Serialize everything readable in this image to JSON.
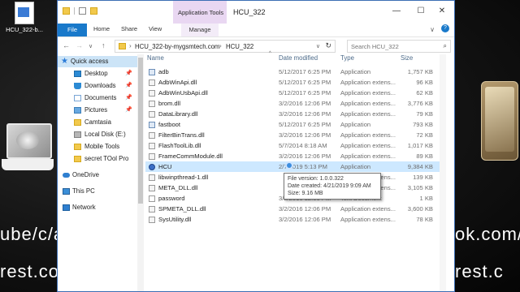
{
  "desktop": {
    "file_icon_label": "HCU_322-b...",
    "bg_text_left_1": "ube/c/a",
    "bg_text_left_2": "rest.com",
    "bg_text_right_1": "ok.com/a",
    "bg_text_right_2": "rest.c"
  },
  "window": {
    "title": "HCU_322",
    "context_tab": "Application Tools",
    "buttons": {
      "minimize": "—",
      "maximize": "☐",
      "close": "✕"
    }
  },
  "ribbon": {
    "tabs": {
      "file": "File",
      "home": "Home",
      "share": "Share",
      "view": "View",
      "manage": "Manage"
    },
    "chevron": "∨",
    "help": "?"
  },
  "address": {
    "crumbs": [
      "HCU_322-by-mygsmtech.com",
      "HCU_322"
    ],
    "separator": "›",
    "search_placeholder": "Search HCU_322"
  },
  "nav": {
    "items": [
      {
        "label": "Quick access",
        "icon": "star-icon",
        "pinned": false
      },
      {
        "label": "Desktop",
        "icon": "desktop-icon",
        "pinned": true
      },
      {
        "label": "Downloads",
        "icon": "downloads-icon",
        "pinned": true
      },
      {
        "label": "Documents",
        "icon": "documents-icon",
        "pinned": true
      },
      {
        "label": "Pictures",
        "icon": "pictures-icon",
        "pinned": true
      },
      {
        "label": "Camtasia",
        "icon": "folder-icon",
        "pinned": false
      },
      {
        "label": "Local Disk (E:)",
        "icon": "disk-icon",
        "pinned": false
      },
      {
        "label": "Mobile Tools",
        "icon": "folder-icon",
        "pinned": false
      },
      {
        "label": "secret TOol Pro",
        "icon": "folder-icon",
        "pinned": false
      },
      {
        "label": "OneDrive",
        "icon": "cloud-icon",
        "pinned": false
      },
      {
        "label": "This PC",
        "icon": "pc-icon",
        "pinned": false
      },
      {
        "label": "Network",
        "icon": "network-icon",
        "pinned": false
      }
    ]
  },
  "columns": {
    "name": "Name",
    "date": "Date modified",
    "type": "Type",
    "size": "Size",
    "sort": "^"
  },
  "files": [
    {
      "name": "adb",
      "date": "5/12/2017 6:25 PM",
      "type": "Application",
      "size": "1,757 KB",
      "icon": "app"
    },
    {
      "name": "AdbWinApi.dll",
      "date": "5/12/2017 6:25 PM",
      "type": "Application extens...",
      "size": "96 KB",
      "icon": "dll"
    },
    {
      "name": "AdbWinUsbApi.dll",
      "date": "5/12/2017 6:25 PM",
      "type": "Application extens...",
      "size": "62 KB",
      "icon": "dll"
    },
    {
      "name": "brom.dll",
      "date": "3/2/2016 12:06 PM",
      "type": "Application extens...",
      "size": "3,776 KB",
      "icon": "dll"
    },
    {
      "name": "DataLibrary.dll",
      "date": "3/2/2016 12:06 PM",
      "type": "Application extens...",
      "size": "79 KB",
      "icon": "dll"
    },
    {
      "name": "fastboot",
      "date": "5/12/2017 6:25 PM",
      "type": "Application",
      "size": "793 KB",
      "icon": "app"
    },
    {
      "name": "FilterBinTrans.dll",
      "date": "3/2/2016 12:06 PM",
      "type": "Application extens...",
      "size": "72 KB",
      "icon": "dll"
    },
    {
      "name": "FlashToolLib.dll",
      "date": "5/7/2014 8:18 AM",
      "type": "Application extens...",
      "size": "1,017 KB",
      "icon": "dll"
    },
    {
      "name": "FrameCommModule.dll",
      "date": "3/2/2016 12:06 PM",
      "type": "Application extens...",
      "size": "89 KB",
      "icon": "dll"
    },
    {
      "name": "HCU",
      "date": "2/7/2019 5:13 PM",
      "type": "Application",
      "size": "9,384 KB",
      "icon": "hcu",
      "selected": true
    },
    {
      "name": "libwinpthread-1.dll",
      "date": "",
      "type": "Application extens...",
      "size": "139 KB",
      "icon": "dll"
    },
    {
      "name": "META_DLL.dll",
      "date": "",
      "type": "Application extens...",
      "size": "3,105 KB",
      "icon": "dll"
    },
    {
      "name": "password",
      "date": "3/2/2016 12:06 PM",
      "type": "Text Document",
      "size": "1 KB",
      "icon": "txt"
    },
    {
      "name": "SPMETA_DLL.dll",
      "date": "3/2/2016 12:06 PM",
      "type": "Application extens...",
      "size": "3,600 KB",
      "icon": "dll"
    },
    {
      "name": "SysUtility.dll",
      "date": "3/2/2016 12:06 PM",
      "type": "Application extens...",
      "size": "78 KB",
      "icon": "dll"
    }
  ],
  "tooltip": {
    "line1": "File version: 1.0.0.322",
    "line2": "Date created: 4/21/2019 9:09 AM",
    "line3": "Size: 9.16 MB"
  }
}
